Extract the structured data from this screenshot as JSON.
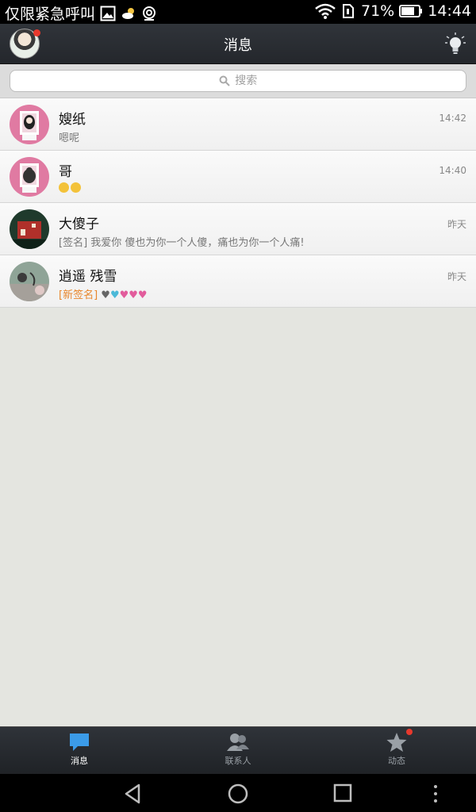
{
  "status_bar": {
    "carrier": "仅限紧急呼叫",
    "battery": "71%",
    "time": "14:44"
  },
  "header": {
    "title": "消息"
  },
  "search": {
    "placeholder": "搜索"
  },
  "conversations": [
    {
      "name": "嫂纸",
      "message": "嗯呢",
      "time": "14:42"
    },
    {
      "name": "哥",
      "message": "",
      "time": "14:40"
    },
    {
      "name": "大傻子",
      "message": "[签名] 我爱你 傻也为你一个人傻，痛也为你一个人痛!",
      "time": "昨天"
    },
    {
      "name": "逍遥  残雪",
      "message_tag": "[新签名]",
      "time": "昨天"
    }
  ],
  "tabs": [
    {
      "label": "消息"
    },
    {
      "label": "联系人"
    },
    {
      "label": "动态"
    }
  ],
  "colors": {
    "accent": "#3b9be8",
    "badge": "#e8392d",
    "signature_tag": "#e8862c"
  }
}
